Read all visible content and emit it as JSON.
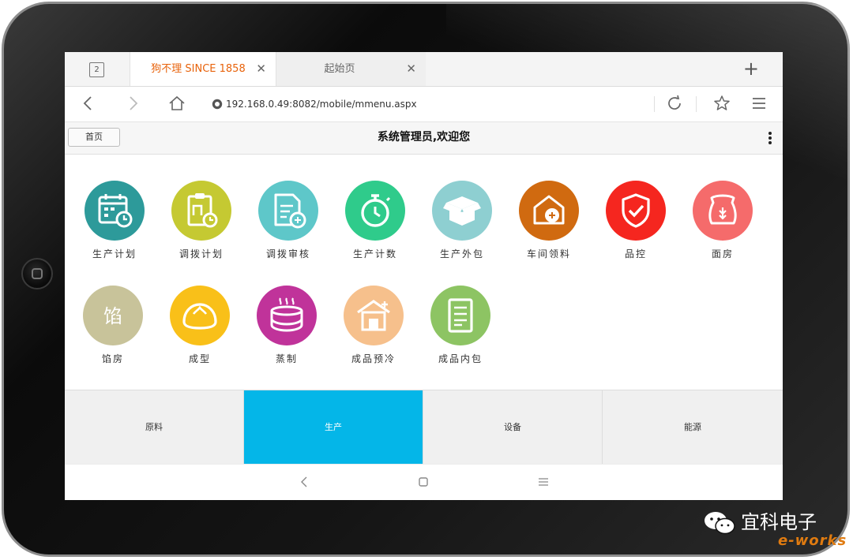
{
  "browser": {
    "tab_count": "2",
    "tabs": [
      {
        "label": "狗不理 SINCE 1858",
        "active": true
      },
      {
        "label": "起始页",
        "active": false
      }
    ],
    "url": "192.168.0.49:8082/mobile/mmenu.aspx"
  },
  "app": {
    "home_label": "首页",
    "welcome": "系统管理员,欢迎您"
  },
  "menu": [
    {
      "label": "生产计划",
      "color": "#2d9a9a",
      "icon": "calendar-clock-icon"
    },
    {
      "label": "调拨计划",
      "color": "#c5c932",
      "icon": "clipboard-transfer-icon"
    },
    {
      "label": "调拨审核",
      "color": "#5ec7c9",
      "icon": "document-audit-icon"
    },
    {
      "label": "生产计数",
      "color": "#2fcb8b",
      "icon": "stopwatch-icon"
    },
    {
      "label": "生产外包",
      "color": "#8ecfd1",
      "icon": "open-box-icon"
    },
    {
      "label": "车间领料",
      "color": "#d06a10",
      "icon": "workshop-material-icon"
    },
    {
      "label": "品控",
      "color": "#f5261f",
      "icon": "shield-check-icon"
    },
    {
      "label": "面房",
      "color": "#f56b6b",
      "icon": "flour-sack-icon"
    },
    {
      "label": "馅房",
      "color": "#c8c39a",
      "icon": "filling-icon",
      "glyph": "馅"
    },
    {
      "label": "成型",
      "color": "#f9c019",
      "icon": "bun-icon"
    },
    {
      "label": "蒸制",
      "color": "#c0339a",
      "icon": "steamer-icon"
    },
    {
      "label": "成品预冷",
      "color": "#f6c08c",
      "icon": "cooling-house-icon"
    },
    {
      "label": "成品内包",
      "color": "#8dc463",
      "icon": "inner-package-icon"
    }
  ],
  "categories": [
    {
      "label": "原料",
      "selected": false
    },
    {
      "label": "生产",
      "selected": true
    },
    {
      "label": "设备",
      "selected": false
    },
    {
      "label": "能源",
      "selected": false
    }
  ],
  "watermark": {
    "text": "宜科电子",
    "sub": "e-works"
  }
}
